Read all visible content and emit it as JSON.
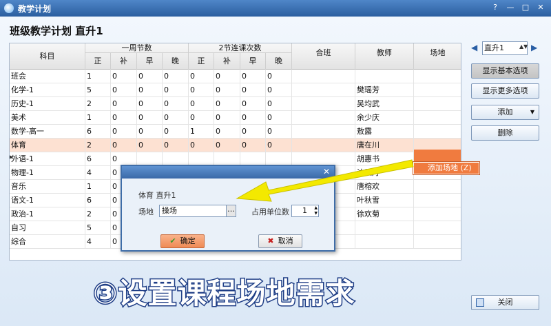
{
  "window": {
    "title": "教学计划",
    "buttons": [
      "?",
      "—",
      "□",
      "✕"
    ]
  },
  "page": {
    "heading": "班级教学计划   直升1"
  },
  "table": {
    "headers": {
      "subject": "科目",
      "week_group": "一周节数",
      "double_group": "2节连课次数",
      "merged_class": "合班",
      "teacher": "教师",
      "venue": "场地",
      "sub": [
        "正",
        "补",
        "早",
        "晚",
        "正",
        "补",
        "早",
        "晚"
      ]
    },
    "rows": [
      {
        "subject": "班会",
        "v": [
          "1",
          "0",
          "0",
          "0",
          "0",
          "0",
          "0",
          "0"
        ],
        "teacher": ""
      },
      {
        "subject": "化学-1",
        "v": [
          "5",
          "0",
          "0",
          "0",
          "0",
          "0",
          "0",
          "0"
        ],
        "teacher": "樊瑶芳"
      },
      {
        "subject": "历史-1",
        "v": [
          "2",
          "0",
          "0",
          "0",
          "0",
          "0",
          "0",
          "0"
        ],
        "teacher": "吴均武"
      },
      {
        "subject": "美术",
        "v": [
          "1",
          "0",
          "0",
          "0",
          "0",
          "0",
          "0",
          "0"
        ],
        "teacher": "余少庆"
      },
      {
        "subject": "数学-高一",
        "v": [
          "6",
          "0",
          "0",
          "0",
          "1",
          "0",
          "0",
          "0"
        ],
        "teacher": "敖露"
      },
      {
        "subject": "体育",
        "v": [
          "2",
          "0",
          "0",
          "0",
          "0",
          "0",
          "0",
          "0"
        ],
        "teacher": "唐在川"
      },
      {
        "subject": "外语-1",
        "v": [
          "6",
          "0",
          "",
          "",
          "",
          "",
          "",
          ""
        ],
        "teacher": "胡惠书"
      },
      {
        "subject": "物理-1",
        "v": [
          "4",
          "0",
          "",
          "",
          "",
          "",
          "",
          ""
        ],
        "teacher": "沈凤丹"
      },
      {
        "subject": "音乐",
        "v": [
          "1",
          "0",
          "",
          "",
          "",
          "",
          "",
          ""
        ],
        "teacher": "唐榕欢"
      },
      {
        "subject": "语文-1",
        "v": [
          "6",
          "0",
          "",
          "",
          "",
          "",
          "",
          ""
        ],
        "teacher": "叶秋雪"
      },
      {
        "subject": "政治-1",
        "v": [
          "2",
          "0",
          "",
          "",
          "",
          "",
          "",
          ""
        ],
        "teacher": "徐欢菊"
      },
      {
        "subject": "自习",
        "v": [
          "5",
          "0",
          "",
          "",
          "",
          "",
          "",
          ""
        ],
        "teacher": ""
      },
      {
        "subject": "综合",
        "v": [
          "4",
          "0",
          "",
          "",
          "",
          "",
          "",
          ""
        ],
        "teacher": ""
      }
    ]
  },
  "side": {
    "class_value": "直升1",
    "show_basic": "显示基本选项",
    "show_more": "显示更多选项",
    "add": "添加",
    "delete": "删除",
    "close": "关闭"
  },
  "context_menu": {
    "item": "添加场地 (Z)"
  },
  "dialog": {
    "subject_label": "体育 直升1",
    "venue_label": "场地",
    "venue_value": "操场",
    "units_label": "占用单位数",
    "units_value": "1",
    "ok": "确定",
    "cancel": "取消"
  },
  "caption": "③设置课程场地需求",
  "colors": {
    "accent": "#f07b3f",
    "title_bar": "#2b5e9f",
    "arrow": "#f3e900"
  }
}
